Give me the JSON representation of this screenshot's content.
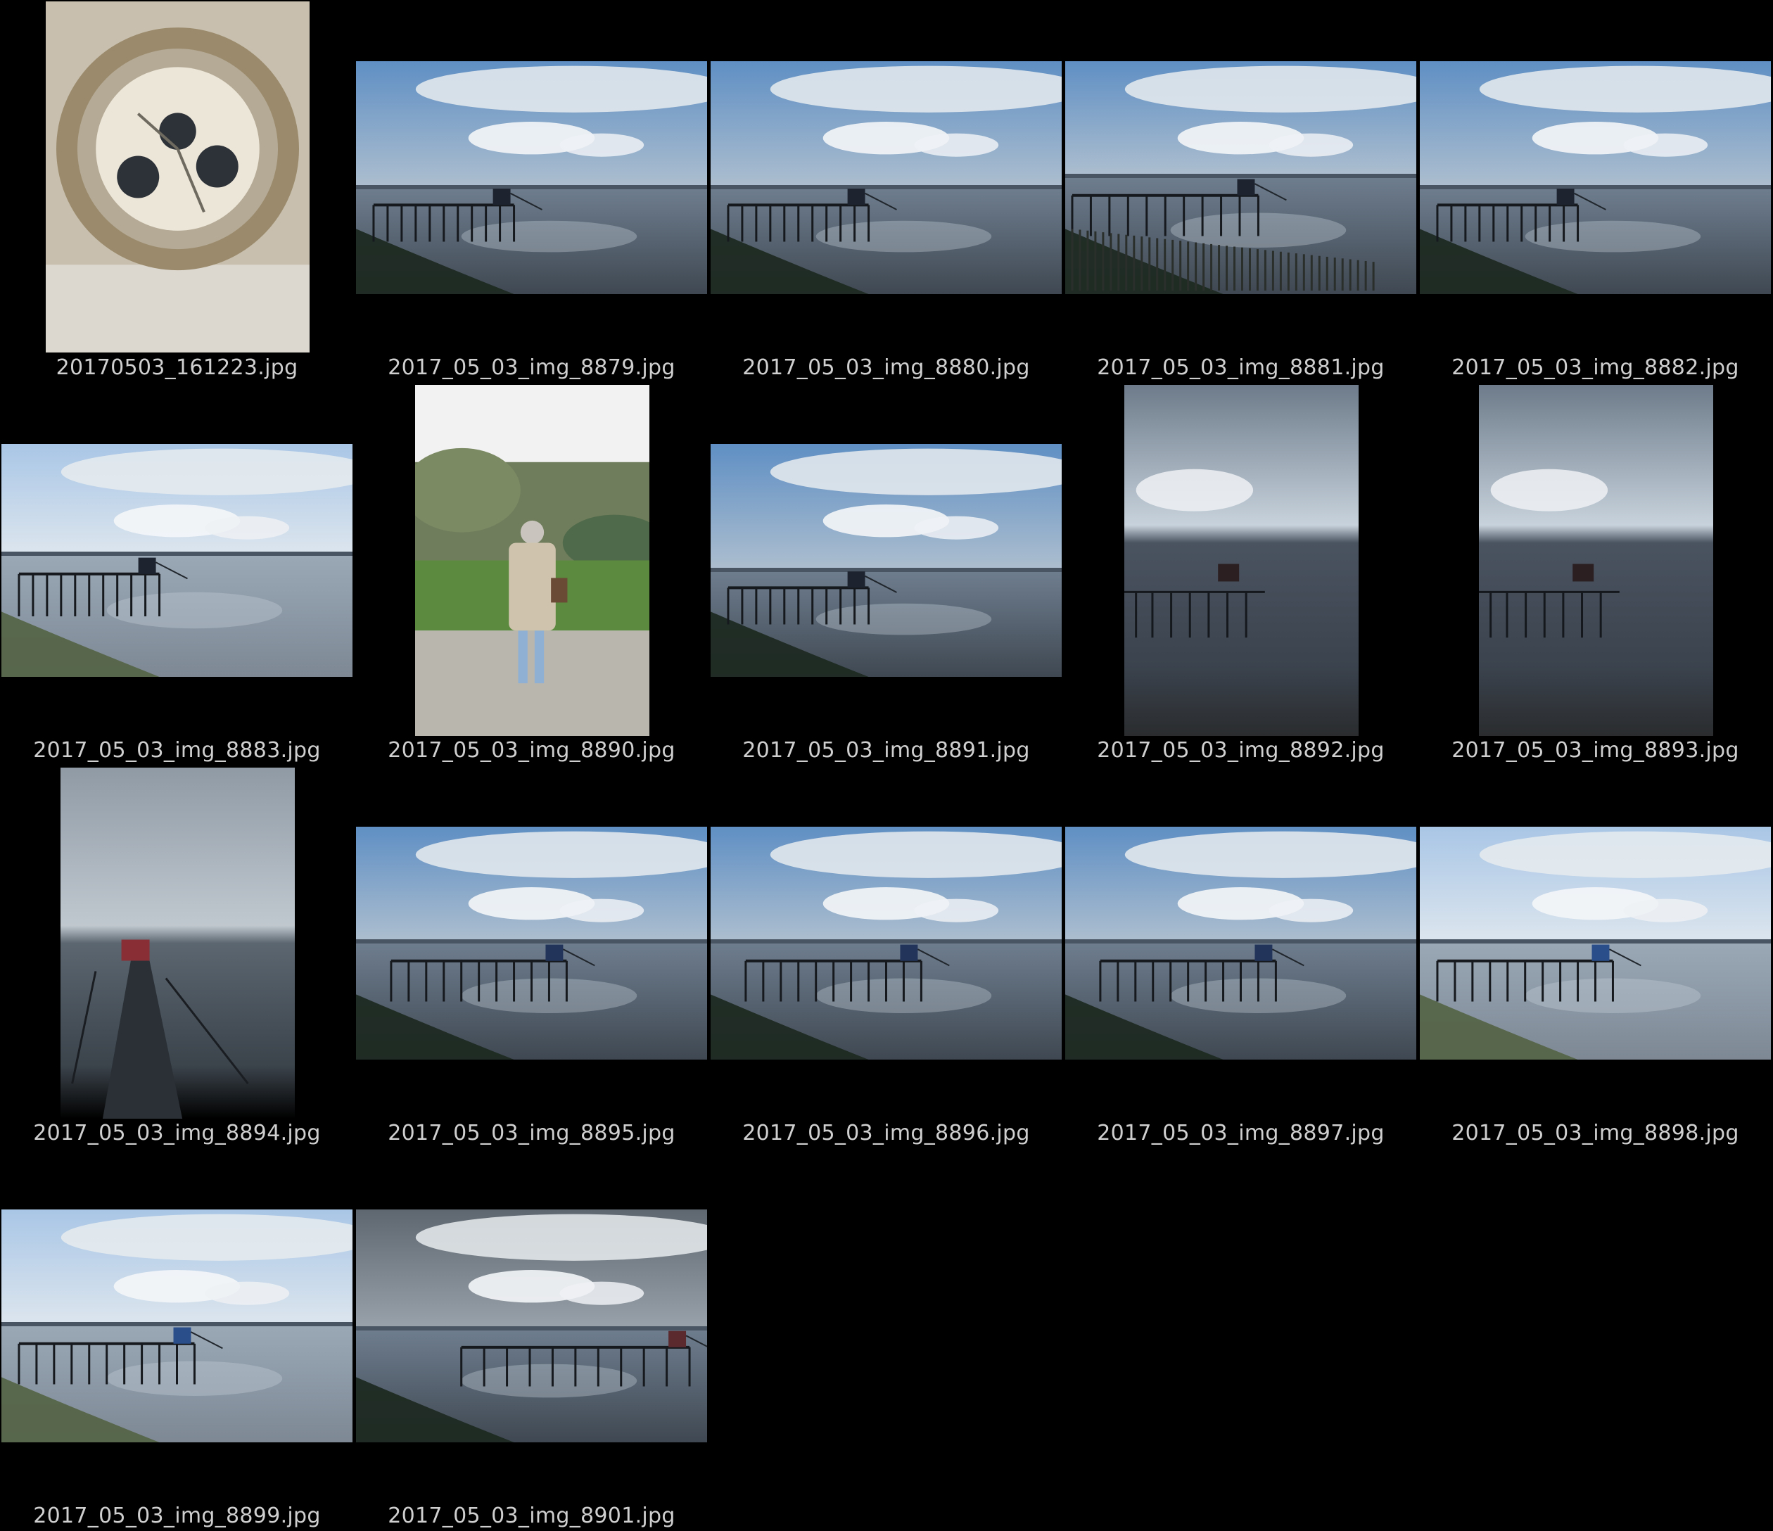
{
  "gallery": {
    "items": [
      {
        "filename": "20170503_161223.jpg",
        "kind": "watch"
      },
      {
        "filename": "2017_05_03_img_8879.jpg",
        "kind": "pier-landscape"
      },
      {
        "filename": "2017_05_03_img_8880.jpg",
        "kind": "pier-landscape"
      },
      {
        "filename": "2017_05_03_img_8881.jpg",
        "kind": "pier-landscape-fence"
      },
      {
        "filename": "2017_05_03_img_8882.jpg",
        "kind": "pier-landscape"
      },
      {
        "filename": "2017_05_03_img_8883.jpg",
        "kind": "pier-landscape-bright"
      },
      {
        "filename": "2017_05_03_img_8890.jpg",
        "kind": "person-portrait"
      },
      {
        "filename": "2017_05_03_img_8891.jpg",
        "kind": "pier-landscape"
      },
      {
        "filename": "2017_05_03_img_8892.jpg",
        "kind": "pier-portrait"
      },
      {
        "filename": "2017_05_03_img_8893.jpg",
        "kind": "pier-portrait"
      },
      {
        "filename": "2017_05_03_img_8894.jpg",
        "kind": "walkway-portrait"
      },
      {
        "filename": "2017_05_03_img_8895.jpg",
        "kind": "pier-long"
      },
      {
        "filename": "2017_05_03_img_8896.jpg",
        "kind": "pier-long"
      },
      {
        "filename": "2017_05_03_img_8897.jpg",
        "kind": "pier-long"
      },
      {
        "filename": "2017_05_03_img_8898.jpg",
        "kind": "pier-long-bright"
      },
      {
        "filename": "2017_05_03_img_8899.jpg",
        "kind": "pier-long-bright"
      },
      {
        "filename": "2017_05_03_img_8901.jpg",
        "kind": "pier-stormy"
      }
    ]
  },
  "colors": {
    "background": "#000000",
    "caption": "#cfcfcf",
    "sky": "#7fa6cf",
    "water": "#6f7c8c"
  }
}
